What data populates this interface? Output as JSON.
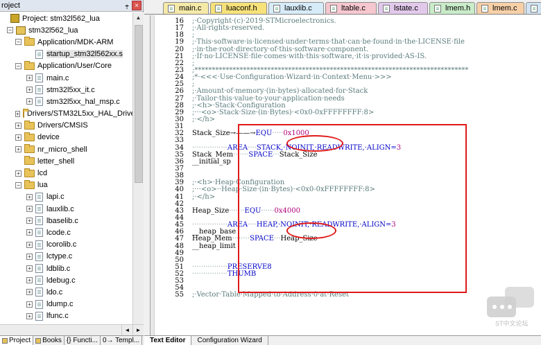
{
  "project_panel": {
    "title": "roject",
    "pin": "⨥",
    "close": "×",
    "tree": [
      {
        "label": "Project: stm32l562_lua",
        "kind": "project",
        "exp": "",
        "indent": 0
      },
      {
        "label": "stm32l562_lua",
        "kind": "target",
        "exp": "−",
        "indent": 1
      },
      {
        "label": "Application/MDK-ARM",
        "kind": "folder",
        "exp": "−",
        "indent": 2
      },
      {
        "label": "startup_stm32l562xx.s",
        "kind": "file",
        "exp": "",
        "indent": 3,
        "selected": true
      },
      {
        "label": "Application/User/Core",
        "kind": "folder",
        "exp": "−",
        "indent": 2
      },
      {
        "label": "main.c",
        "kind": "file",
        "exp": "+",
        "indent": 3
      },
      {
        "label": "stm32l5xx_it.c",
        "kind": "file",
        "exp": "+",
        "indent": 3
      },
      {
        "label": "stm32l5xx_hal_msp.c",
        "kind": "file",
        "exp": "+",
        "indent": 3
      },
      {
        "label": "Drivers/STM32L5xx_HAL_Drive",
        "kind": "folder",
        "exp": "+",
        "indent": 2
      },
      {
        "label": "Drivers/CMSIS",
        "kind": "folder",
        "exp": "+",
        "indent": 2
      },
      {
        "label": "device",
        "kind": "folder",
        "exp": "+",
        "indent": 2
      },
      {
        "label": "nr_micro_shell",
        "kind": "folder",
        "exp": "+",
        "indent": 2
      },
      {
        "label": "letter_shell",
        "kind": "folder",
        "exp": "",
        "indent": 2
      },
      {
        "label": "lcd",
        "kind": "folder",
        "exp": "+",
        "indent": 2
      },
      {
        "label": "lua",
        "kind": "folder",
        "exp": "−",
        "indent": 2
      },
      {
        "label": "lapi.c",
        "kind": "file",
        "exp": "+",
        "indent": 3
      },
      {
        "label": "lauxlib.c",
        "kind": "file",
        "exp": "+",
        "indent": 3
      },
      {
        "label": "lbaselib.c",
        "kind": "file",
        "exp": "+",
        "indent": 3
      },
      {
        "label": "lcode.c",
        "kind": "file",
        "exp": "+",
        "indent": 3
      },
      {
        "label": "lcorolib.c",
        "kind": "file",
        "exp": "+",
        "indent": 3
      },
      {
        "label": "lctype.c",
        "kind": "file",
        "exp": "+",
        "indent": 3
      },
      {
        "label": "ldblib.c",
        "kind": "file",
        "exp": "+",
        "indent": 3
      },
      {
        "label": "ldebug.c",
        "kind": "file",
        "exp": "+",
        "indent": 3
      },
      {
        "label": "ldo.c",
        "kind": "file",
        "exp": "+",
        "indent": 3
      },
      {
        "label": "ldump.c",
        "kind": "file",
        "exp": "+",
        "indent": 3
      },
      {
        "label": "lfunc.c",
        "kind": "file",
        "exp": "+",
        "indent": 3
      }
    ],
    "scroll_up": "▲",
    "scroll_left": "◄",
    "scroll_right": "►",
    "bottom_tabs": [
      "Project",
      "Books",
      "{} Functi...",
      "0→ Templ..."
    ]
  },
  "file_tabs": [
    {
      "label": "main.c",
      "color": "#f5e9a8"
    },
    {
      "label": "luaconf.h",
      "color": "#f7e27a"
    },
    {
      "label": "lauxlib.c",
      "color": "#d7ecf9"
    },
    {
      "label": "ltable.c",
      "color": "#f6c7cf"
    },
    {
      "label": "lstate.c",
      "color": "#e2c9ec"
    },
    {
      "label": "lmem.h",
      "color": "#c9ecc9"
    },
    {
      "label": "lmem.c",
      "color": "#f7d0a8"
    },
    {
      "label": "lstate.h",
      "color": "#cfe3f3"
    }
  ],
  "code": [
    {
      "n": "16",
      "parts": [
        {
          "c": "cmt",
          "t": ";·Copyright·(c)·2019·STMicroelectronics."
        }
      ]
    },
    {
      "n": "17",
      "parts": [
        {
          "c": "cmt",
          "t": ";·All·rights·reserved."
        }
      ]
    },
    {
      "n": "18",
      "parts": [
        {
          "c": "cmt",
          "t": ";"
        }
      ]
    },
    {
      "n": "19",
      "parts": [
        {
          "c": "cmt",
          "t": ";·This·software·is·licensed·under·terms·that·can·be·found·in·the·LICENSE·file"
        }
      ]
    },
    {
      "n": "20",
      "parts": [
        {
          "c": "cmt",
          "t": ";·in·the·root·directory·of·this·software·component."
        }
      ]
    },
    {
      "n": "21",
      "parts": [
        {
          "c": "cmt",
          "t": ";·If·no·LICENSE·file·comes·with·this·software,·it·is·provided·AS-IS."
        }
      ]
    },
    {
      "n": "22",
      "parts": [
        {
          "c": "cmt",
          "t": ";"
        }
      ]
    },
    {
      "n": "23",
      "parts": [
        {
          "c": "cmt",
          "t": ";*******************************************************************************"
        }
      ]
    },
    {
      "n": "24",
      "parts": [
        {
          "c": "cmt",
          "t": ";*·<<<·Use·Configuration·Wizard·in·Context·Menu·>>>"
        }
      ]
    },
    {
      "n": "25",
      "parts": [
        {
          "c": "cmt",
          "t": ";"
        }
      ]
    },
    {
      "n": "26",
      "parts": [
        {
          "c": "cmt",
          "t": ";·Amount·of·memory·(in·bytes)·allocated·for·Stack"
        }
      ]
    },
    {
      "n": "27",
      "parts": [
        {
          "c": "cmt",
          "t": ";·Tailor·this·value·to·your·application·needs"
        }
      ]
    },
    {
      "n": "28",
      "parts": [
        {
          "c": "cmt",
          "t": ";·<h>·Stack·Configuration"
        }
      ]
    },
    {
      "n": "29",
      "parts": [
        {
          "c": "cmt",
          "t": ";···<o>·Stack·Size·(in·Bytes)·<0x0-0xFFFFFFFF:8>"
        }
      ]
    },
    {
      "n": "30",
      "parts": [
        {
          "c": "cmt",
          "t": ";·</h>"
        }
      ]
    },
    {
      "n": "31",
      "parts": [
        {
          "c": "ctext",
          "t": ""
        }
      ]
    },
    {
      "n": "32",
      "parts": [
        {
          "c": "ctext",
          "t": "Stack_Size→——→"
        },
        {
          "c": "kw",
          "t": "EQU"
        },
        {
          "c": "dots",
          "t": "·····"
        },
        {
          "c": "num",
          "t": "0x1000"
        }
      ]
    },
    {
      "n": "33",
      "parts": [
        {
          "c": "ctext",
          "t": ""
        }
      ]
    },
    {
      "n": "34",
      "parts": [
        {
          "c": "dots",
          "t": "················"
        },
        {
          "c": "kw",
          "t": "AREA"
        },
        {
          "c": "dots",
          "t": "····"
        },
        {
          "c": "kw",
          "t": "STACK,·NOINIT,·READWRITE,·ALIGN="
        },
        {
          "c": "num",
          "t": "3"
        }
      ]
    },
    {
      "n": "35",
      "parts": [
        {
          "c": "ctext",
          "t": "Stack_Mem"
        },
        {
          "c": "dots",
          "t": "·······"
        },
        {
          "c": "kw",
          "t": "SPACE"
        },
        {
          "c": "dots",
          "t": "···"
        },
        {
          "c": "ctext",
          "t": "Stack_Size"
        }
      ]
    },
    {
      "n": "36",
      "parts": [
        {
          "c": "ctext",
          "t": "__initial_sp"
        }
      ]
    },
    {
      "n": "37",
      "parts": [
        {
          "c": "ctext",
          "t": ""
        }
      ]
    },
    {
      "n": "38",
      "parts": [
        {
          "c": "ctext",
          "t": ""
        }
      ]
    },
    {
      "n": "39",
      "parts": [
        {
          "c": "cmt",
          "t": ";·<h>·Heap·Configuration"
        }
      ]
    },
    {
      "n": "40",
      "parts": [
        {
          "c": "cmt",
          "t": ";···<o>··Heap·Size·(in·Bytes)·<0x0-0xFFFFFFFF:8>"
        }
      ]
    },
    {
      "n": "41",
      "parts": [
        {
          "c": "cmt",
          "t": ";·</h>"
        }
      ]
    },
    {
      "n": "42",
      "parts": [
        {
          "c": "ctext",
          "t": ""
        }
      ]
    },
    {
      "n": "43",
      "parts": [
        {
          "c": "ctext",
          "t": "Heap_Size"
        },
        {
          "c": "dots",
          "t": "·······"
        },
        {
          "c": "kw",
          "t": "EQU"
        },
        {
          "c": "dots",
          "t": "······"
        },
        {
          "c": "num",
          "t": "0x4000"
        }
      ]
    },
    {
      "n": "44",
      "parts": [
        {
          "c": "ctext",
          "t": ""
        }
      ]
    },
    {
      "n": "45",
      "parts": [
        {
          "c": "dots",
          "t": "················"
        },
        {
          "c": "kw",
          "t": "AREA"
        },
        {
          "c": "dots",
          "t": "····"
        },
        {
          "c": "kw",
          "t": "HEAP,·NOINIT,·READWRITE,·ALIGN="
        },
        {
          "c": "num",
          "t": "3"
        }
      ]
    },
    {
      "n": "46",
      "parts": [
        {
          "c": "ctext",
          "t": "__heap_base"
        }
      ]
    },
    {
      "n": "47",
      "parts": [
        {
          "c": "ctext",
          "t": "Heap_Mem"
        },
        {
          "c": "dots",
          "t": "········"
        },
        {
          "c": "kw",
          "t": "SPACE"
        },
        {
          "c": "dots",
          "t": "···"
        },
        {
          "c": "ctext",
          "t": "Heap_Size"
        }
      ]
    },
    {
      "n": "48",
      "parts": [
        {
          "c": "ctext",
          "t": "__heap_limit"
        }
      ]
    },
    {
      "n": "49",
      "parts": [
        {
          "c": "ctext",
          "t": ""
        }
      ]
    },
    {
      "n": "50",
      "parts": [
        {
          "c": "ctext",
          "t": ""
        }
      ]
    },
    {
      "n": "51",
      "parts": [
        {
          "c": "dots",
          "t": "················"
        },
        {
          "c": "kw",
          "t": "PRESERVE8"
        }
      ]
    },
    {
      "n": "52",
      "parts": [
        {
          "c": "dots",
          "t": "················"
        },
        {
          "c": "kw",
          "t": "THUMB"
        }
      ]
    },
    {
      "n": "53",
      "parts": [
        {
          "c": "ctext",
          "t": ""
        }
      ]
    },
    {
      "n": "54",
      "parts": [
        {
          "c": "ctext",
          "t": ""
        }
      ]
    },
    {
      "n": "55",
      "parts": [
        {
          "c": "cmt",
          "t": ";·Vector·Table·Mapped·to·Address·0·at·Reset"
        }
      ]
    }
  ],
  "editor_bottom_tabs": [
    "Text Editor",
    "Configuration Wizard"
  ],
  "watermark": {
    "text": "ST中文论坛"
  },
  "colors": {
    "annotation": "#e01818",
    "keyword": "#0000c8",
    "number": "#b0007a",
    "comment": "#5a7a7a"
  }
}
